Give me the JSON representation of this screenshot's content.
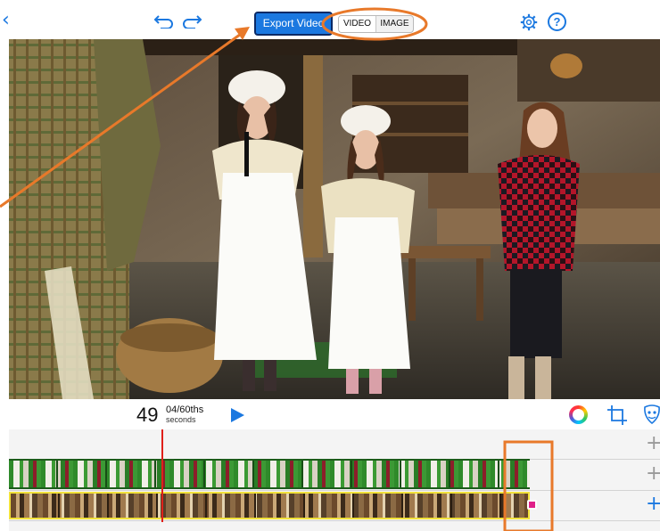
{
  "toolbar": {
    "export_label": "Export Video",
    "mode_options": [
      "VIDEO",
      "IMAGE"
    ],
    "selected_mode": "VIDEO",
    "help_label": "?",
    "icons": [
      "chevron-left-icon",
      "undo-icon",
      "redo-icon",
      "gear-icon",
      "help-icon"
    ]
  },
  "transport": {
    "seconds": "49",
    "fraction": "04/60ths",
    "unit": "seconds",
    "icons": [
      "play-icon",
      "color-wheel-icon",
      "crop-icon",
      "mask-icon"
    ]
  },
  "timeline": {
    "add_track_label": "+",
    "tracks": [
      "green-screen-clip",
      "background-clip"
    ]
  },
  "colors": {
    "accent": "#1b78e0",
    "annotation": "#e8792a",
    "playhead": "#e0201a",
    "selected_clip_border": "#f2e23a",
    "end_marker": "#e0218a"
  }
}
